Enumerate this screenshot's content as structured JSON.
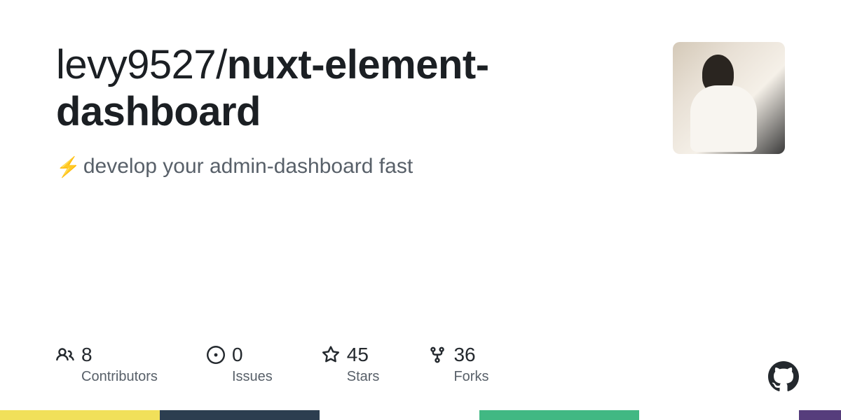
{
  "repo": {
    "owner": "levy9527",
    "separator": "/",
    "name": "nuxt-element-dashboard"
  },
  "description": {
    "emoji": "⚡",
    "text": "develop your admin-dashboard fast"
  },
  "stats": {
    "contributors": {
      "value": "8",
      "label": "Contributors"
    },
    "issues": {
      "value": "0",
      "label": "Issues"
    },
    "stars": {
      "value": "45",
      "label": "Stars"
    },
    "forks": {
      "value": "36",
      "label": "Forks"
    }
  }
}
